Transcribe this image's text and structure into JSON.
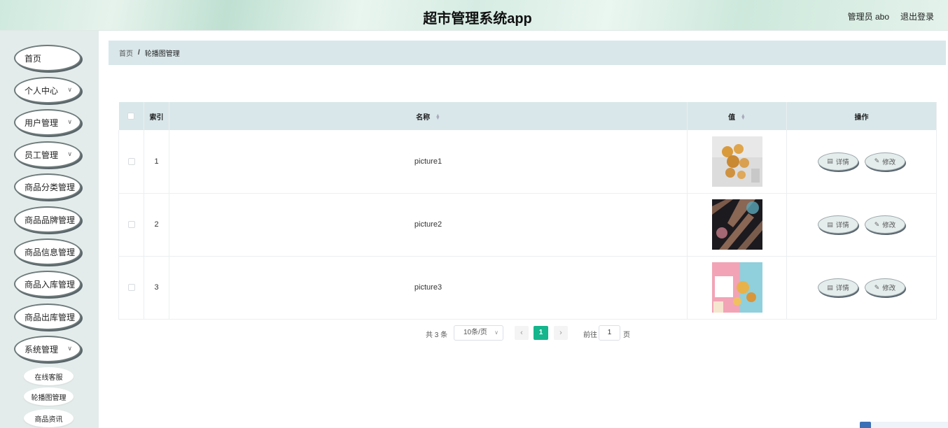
{
  "header": {
    "title": "超市管理系统app",
    "user_label": "管理员 abo",
    "logout_label": "退出登录"
  },
  "sidebar": {
    "items": [
      {
        "label": "首页",
        "has_chevron": false
      },
      {
        "label": "个人中心",
        "has_chevron": true
      },
      {
        "label": "用户管理",
        "has_chevron": true
      },
      {
        "label": "员工管理",
        "has_chevron": true
      },
      {
        "label": "商品分类管理",
        "has_chevron": false
      },
      {
        "label": "商品品牌管理",
        "has_chevron": false
      },
      {
        "label": "商品信息管理",
        "has_chevron": false
      },
      {
        "label": "商品入库管理",
        "has_chevron": false
      },
      {
        "label": "商品出库管理",
        "has_chevron": false
      },
      {
        "label": "系统管理",
        "has_chevron": true
      }
    ],
    "sub_items": [
      {
        "label": "在线客服"
      },
      {
        "label": "轮播图管理"
      },
      {
        "label": "商品资讯"
      }
    ]
  },
  "breadcrumb": {
    "home": "首页",
    "separator": "/",
    "current": "轮播图管理"
  },
  "table": {
    "columns": [
      "索引",
      "名称",
      "值",
      "操作"
    ],
    "rows": [
      {
        "index": "1",
        "name": "picture1",
        "image": "pastry-photo"
      },
      {
        "index": "2",
        "name": "picture2",
        "image": "dark-pattern-photo"
      },
      {
        "index": "3",
        "name": "picture3",
        "image": "pink-food-photo"
      }
    ],
    "detail_label": "详情",
    "edit_label": "修改"
  },
  "pagination": {
    "total": "共 3 条",
    "page_size": "10条/页",
    "current_page": "1",
    "goto_label": "前往",
    "goto_value": "1",
    "page_unit": "页"
  },
  "colors": {
    "accent": "#15b58d",
    "breadcrumb_bg": "#d9e7ea",
    "sidebar_bg": "#e4eceb"
  }
}
